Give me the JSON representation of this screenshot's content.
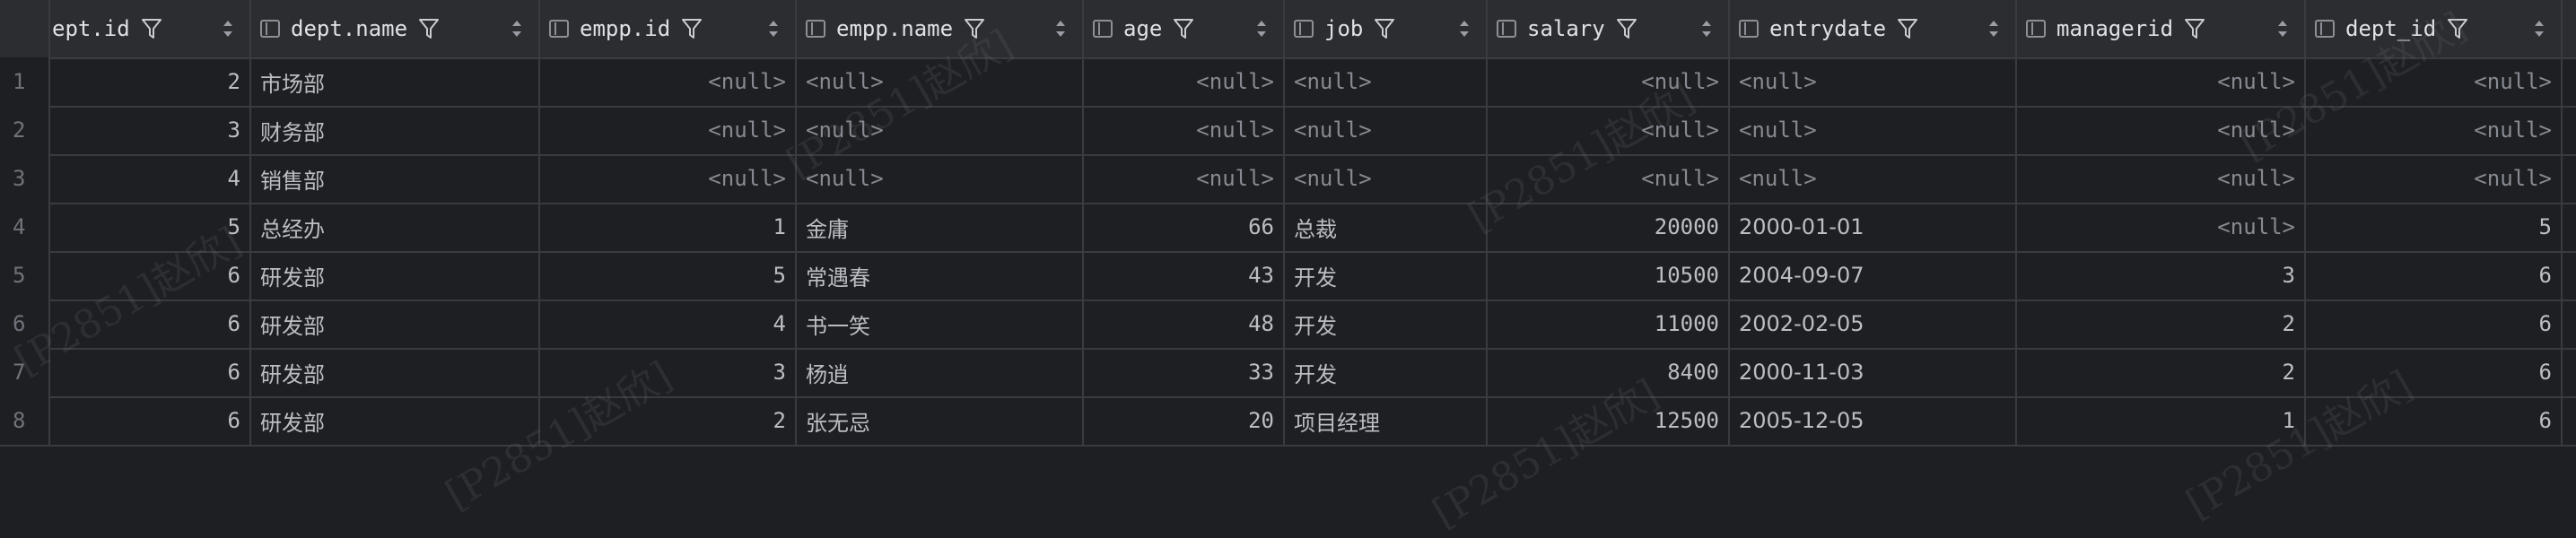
{
  "columns": [
    {
      "key": "dept_id",
      "label": "ept.id",
      "align": "num"
    },
    {
      "key": "dept_name",
      "label": "dept.name",
      "align": "txt"
    },
    {
      "key": "empp_id",
      "label": "empp.id",
      "align": "num"
    },
    {
      "key": "empp_name",
      "label": "empp.name",
      "align": "txt"
    },
    {
      "key": "age",
      "label": "age",
      "align": "num"
    },
    {
      "key": "job",
      "label": "job",
      "align": "txt"
    },
    {
      "key": "salary",
      "label": "salary",
      "align": "num"
    },
    {
      "key": "entrydate",
      "label": "entrydate",
      "align": "txt"
    },
    {
      "key": "managerid",
      "label": "managerid",
      "align": "num"
    },
    {
      "key": "dept_id2",
      "label": "dept_id",
      "align": "num"
    }
  ],
  "null_text": "<null>",
  "rows": [
    {
      "n": "1",
      "cells": [
        "2",
        "市场部",
        null,
        null,
        null,
        null,
        null,
        null,
        null,
        null
      ]
    },
    {
      "n": "2",
      "cells": [
        "3",
        "财务部",
        null,
        null,
        null,
        null,
        null,
        null,
        null,
        null
      ]
    },
    {
      "n": "3",
      "cells": [
        "4",
        "销售部",
        null,
        null,
        null,
        null,
        null,
        null,
        null,
        null
      ]
    },
    {
      "n": "4",
      "cells": [
        "5",
        "总经办",
        "1",
        "金庸",
        "66",
        "总裁",
        "20000",
        "2000-01-01",
        null,
        "5"
      ]
    },
    {
      "n": "5",
      "cells": [
        "6",
        "研发部",
        "5",
        "常遇春",
        "43",
        "开发",
        "10500",
        "2004-09-07",
        "3",
        "6"
      ]
    },
    {
      "n": "6",
      "cells": [
        "6",
        "研发部",
        "4",
        "书一笑",
        "48",
        "开发",
        "11000",
        "2002-02-05",
        "2",
        "6"
      ]
    },
    {
      "n": "7",
      "cells": [
        "6",
        "研发部",
        "3",
        "杨逍",
        "33",
        "开发",
        "8400",
        "2000-11-03",
        "2",
        "6"
      ]
    },
    {
      "n": "8",
      "cells": [
        "6",
        "研发部",
        "2",
        "张无忌",
        "20",
        "项目经理",
        "12500",
        "2005-12-05",
        "1",
        "6"
      ]
    }
  ],
  "watermark_text": "[P2851]赵欣]",
  "colors": {
    "background": "#1e1f22",
    "header": "#2b2d30",
    "grid": "#393b40",
    "text": "#bcbec4",
    "null": "#868a91"
  }
}
